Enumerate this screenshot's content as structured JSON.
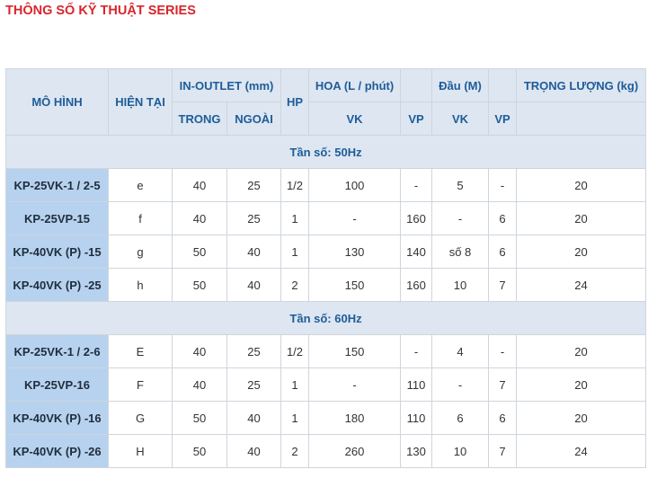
{
  "title": "THÔNG SỐ KỸ THUẬT SERIES",
  "headers": {
    "model": "MÔ HÌNH",
    "current": "HIỆN TẠI",
    "in_outlet": "IN-OUTLET (mm)",
    "hp": "HP",
    "flow": "HOA (L / phút)",
    "head": "Đầu (M)",
    "weight": "TRỌNG LƯỢNG (kg)",
    "inner": "TRONG",
    "outer": "NGOÀI",
    "flow_vk": "VK",
    "flow_vp": "VP",
    "head_vk": "VK",
    "head_vp": "VP"
  },
  "sections": [
    {
      "label": "Tần số: 50Hz",
      "rows": [
        [
          "KP-25VK-1 / 2-5",
          "e",
          "40",
          "25",
          "1/2",
          "100",
          "-",
          "5",
          "-",
          "20"
        ],
        [
          "KP-25VP-15",
          "f",
          "40",
          "25",
          "1",
          "-",
          "160",
          "-",
          "6",
          "20"
        ],
        [
          "KP-40VK (P) -15",
          "g",
          "50",
          "40",
          "1",
          "130",
          "140",
          "số 8",
          "6",
          "20"
        ],
        [
          "KP-40VK (P) -25",
          "h",
          "50",
          "40",
          "2",
          "150",
          "160",
          "10",
          "7",
          "24"
        ]
      ]
    },
    {
      "label": "Tần số: 60Hz",
      "rows": [
        [
          "KP-25VK-1 / 2-6",
          "E",
          "40",
          "25",
          "1/2",
          "150",
          "-",
          "4",
          "-",
          "20"
        ],
        [
          "KP-25VP-16",
          "F",
          "40",
          "25",
          "1",
          "-",
          "110",
          "-",
          "7",
          "20"
        ],
        [
          "KP-40VK (P) -16",
          "G",
          "50",
          "40",
          "1",
          "180",
          "110",
          "6",
          "6",
          "20"
        ],
        [
          "KP-40VK (P) -26",
          "H",
          "50",
          "40",
          "2",
          "260",
          "130",
          "10",
          "7",
          "24"
        ]
      ]
    }
  ]
}
